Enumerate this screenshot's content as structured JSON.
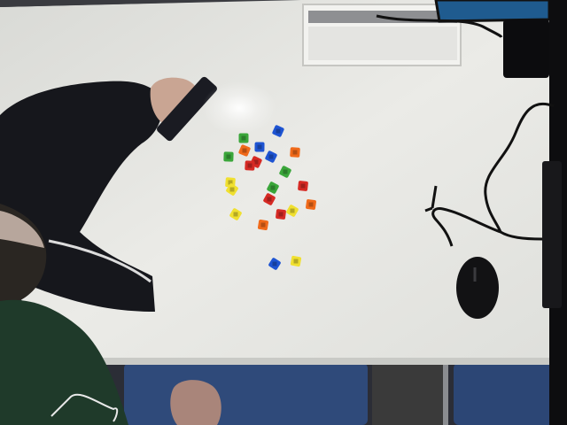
{
  "scene": {
    "description_hidden": "",
    "colors": {
      "table": "#e8e8e4",
      "floor": "#2b2d36",
      "chair": "#2f4a7a",
      "sleeve": "#15161b",
      "skin": "#c9a593",
      "green_shirt": "#1f3a2a",
      "red": "#d62a24",
      "orange": "#f06a1a",
      "yellow": "#f0e030",
      "green": "#3aa63a",
      "blue": "#1e54d2"
    },
    "blocks": [
      {
        "color": "green"
      },
      {
        "color": "orange"
      },
      {
        "color": "blue"
      },
      {
        "color": "blue"
      },
      {
        "color": "green"
      },
      {
        "color": "red"
      },
      {
        "color": "red"
      },
      {
        "color": "blue"
      },
      {
        "color": "orange"
      },
      {
        "color": "green"
      },
      {
        "color": "yellow"
      },
      {
        "color": "green"
      },
      {
        "color": "red"
      },
      {
        "color": "red"
      },
      {
        "color": "red"
      },
      {
        "color": "yellow"
      },
      {
        "color": "orange"
      },
      {
        "color": "yellow"
      },
      {
        "color": "orange"
      },
      {
        "color": "blue"
      },
      {
        "color": "yellow"
      },
      {
        "color": "yellow"
      }
    ]
  }
}
